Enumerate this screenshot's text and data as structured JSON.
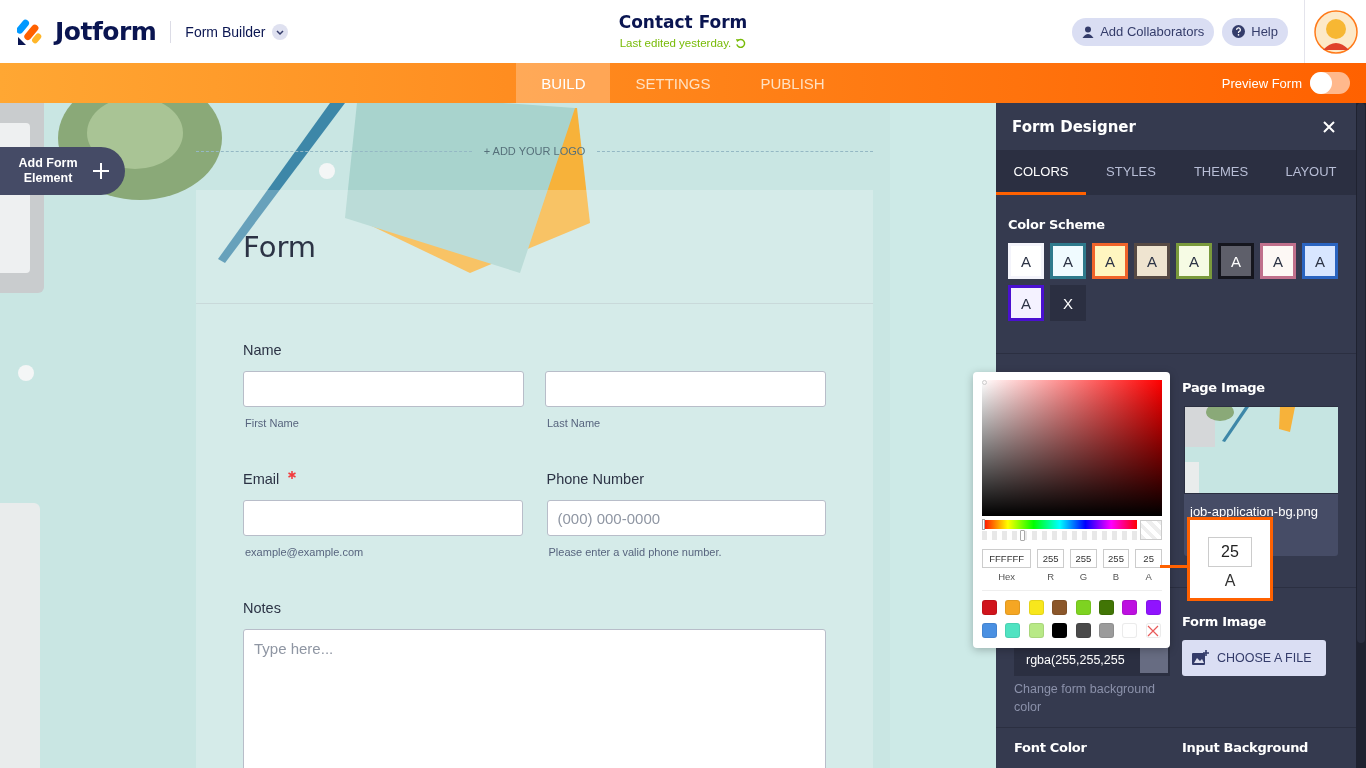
{
  "header": {
    "logo": "Jotform",
    "builder_menu": "Form Builder",
    "form_title": "Contact Form",
    "last_edited": "Last edited yesterday.",
    "buttons": [
      {
        "label": "Add Collaborators",
        "kind": "collaborators"
      },
      {
        "label": "Help",
        "kind": "help"
      }
    ]
  },
  "nav": {
    "tabs": [
      {
        "label": "BUILD",
        "selected": true
      },
      {
        "label": "SETTINGS",
        "selected": false
      },
      {
        "label": "PUBLISH",
        "selected": false
      }
    ],
    "preview": {
      "label": "Preview Form",
      "on": false
    }
  },
  "canvas": {
    "add_element": "Add Form Element",
    "add_logo": "+ ADD YOUR LOGO",
    "form": {
      "title": "Form",
      "rows": [
        {
          "fields": [
            {
              "kind": "fullname",
              "label": "Name",
              "required": false,
              "sublabels": [
                "First Name",
                "Last Name"
              ]
            }
          ]
        },
        {
          "fields": [
            {
              "kind": "text",
              "label": "Email",
              "required": true,
              "hint": "example@example.com"
            },
            {
              "kind": "text",
              "label": "Phone Number",
              "required": false,
              "placeholder": "(000) 000-0000",
              "hint": "Please enter a valid phone number."
            }
          ]
        },
        {
          "fields": [
            {
              "kind": "textarea",
              "label": "Notes",
              "required": false,
              "placeholder": "Type here..."
            }
          ]
        }
      ]
    }
  },
  "designer": {
    "title": "Form Designer",
    "tabs": [
      {
        "label": "COLORS",
        "selected": true
      },
      {
        "label": "STYLES",
        "selected": false
      },
      {
        "label": "THEMES",
        "selected": false
      },
      {
        "label": "LAYOUT",
        "selected": false
      }
    ],
    "color_scheme": {
      "label": "Color Scheme",
      "schemes": [
        {
          "kind": "scheme",
          "text": "A",
          "color": "#f4f4fb",
          "inner": {
            "color": "#ffffff"
          }
        },
        {
          "kind": "scheme",
          "text": "A",
          "color": "#2f7a8c",
          "inner": {
            "color": "#f0fbff"
          }
        },
        {
          "kind": "scheme",
          "text": "A",
          "color": "#f0642a",
          "inner": {
            "color": "#fff6c0"
          }
        },
        {
          "kind": "scheme",
          "text": "A",
          "color": "#574a44",
          "inner": {
            "color": "#efe4d0"
          }
        },
        {
          "kind": "scheme",
          "text": "A",
          "color": "#7a9a3c",
          "inner": {
            "color": "#f6fbe4"
          }
        },
        {
          "kind": "scheme",
          "text": "A",
          "color": "#15161e",
          "inner": {
            "color": "#5e5f6a"
          }
        },
        {
          "kind": "scheme",
          "text": "A",
          "color": "#c0708c",
          "inner": {
            "color": "#fdf8f5"
          }
        },
        {
          "kind": "scheme",
          "text": "A",
          "color": "#2a64c0",
          "inner": {
            "color": "#d8e6ff"
          }
        },
        {
          "kind": "scheme",
          "text": "A",
          "color": "#4a10d0",
          "inner": {
            "color": "#f4f2ff"
          }
        },
        {
          "kind": "reset",
          "text": "X"
        }
      ]
    },
    "page_image": {
      "label": "Page Image",
      "filename": "job-application-bg.png"
    },
    "form_color": {
      "value": "rgba(255,255,255",
      "hint": "Change form background color"
    },
    "form_image": {
      "label": "Form Image",
      "button": "CHOOSE A FILE"
    },
    "bottom_labels": [
      "Font Color",
      "Input Background"
    ]
  },
  "color_picker": {
    "hue": {
      "level": 0
    },
    "alpha": {
      "level": 0.25
    },
    "fields": [
      {
        "label": "Hex",
        "value": "FFFFFF"
      },
      {
        "label": "R",
        "value": "255"
      },
      {
        "label": "G",
        "value": "255"
      },
      {
        "label": "B",
        "value": "255"
      },
      {
        "label": "A",
        "value": "25"
      }
    ],
    "swatches": [
      {
        "kind": "color",
        "color": "#d0141c"
      },
      {
        "kind": "color",
        "color": "#f5a623"
      },
      {
        "kind": "color",
        "color": "#f8e71c"
      },
      {
        "kind": "color",
        "color": "#8b572a"
      },
      {
        "kind": "color",
        "color": "#7ed321"
      },
      {
        "kind": "color",
        "color": "#417505"
      },
      {
        "kind": "color",
        "color": "#bd10e0"
      },
      {
        "kind": "color",
        "color": "#9013fe"
      },
      {
        "kind": "color",
        "color": "#4a90e2"
      },
      {
        "kind": "color",
        "color": "#50e3c2"
      },
      {
        "kind": "color",
        "color": "#b8e986"
      },
      {
        "kind": "color",
        "color": "#000000"
      },
      {
        "kind": "color",
        "color": "#4a4a4a"
      },
      {
        "kind": "color",
        "color": "#9b9b9b"
      },
      {
        "kind": "color",
        "color": "#ffffff"
      },
      {
        "kind": "none"
      }
    ]
  },
  "callout": {
    "value": "25",
    "label": "A"
  }
}
